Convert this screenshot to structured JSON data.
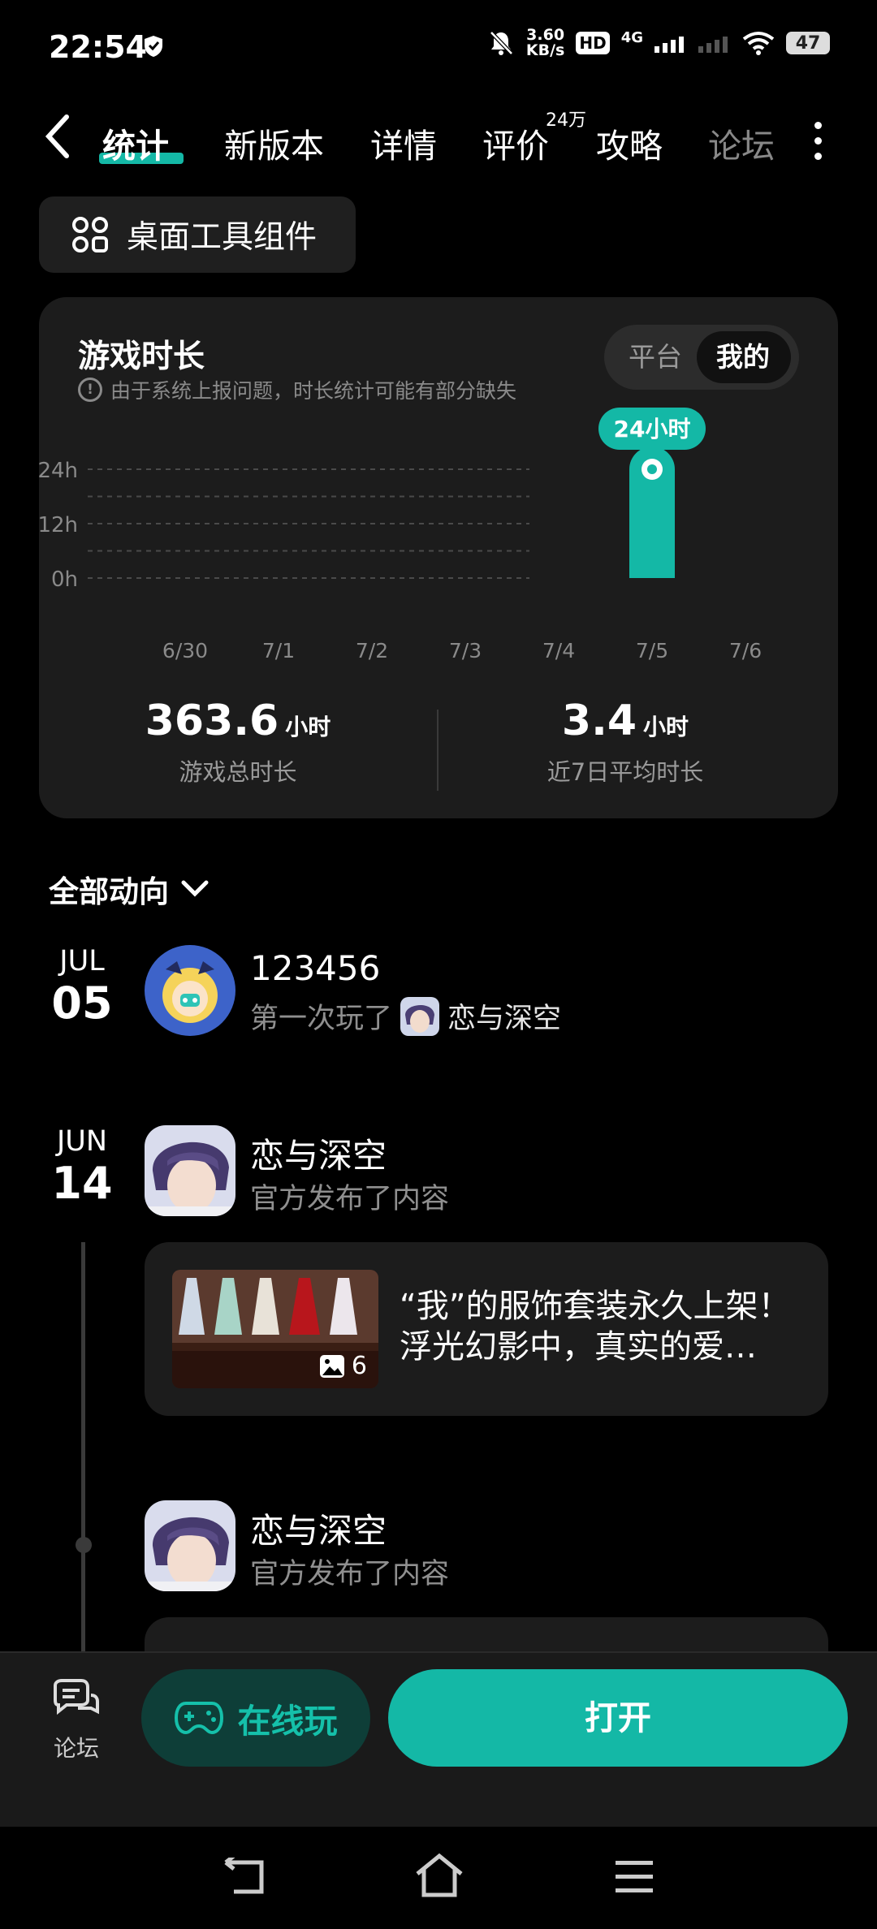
{
  "status_bar": {
    "time": "22:54",
    "net_speed_value": "3.60",
    "net_speed_unit": "KB/s",
    "hd": "HD",
    "network": "4G",
    "battery": "47"
  },
  "tabs": [
    {
      "label": "统计"
    },
    {
      "label": "新版本"
    },
    {
      "label": "详情"
    },
    {
      "label": "评价",
      "badge": "24万"
    },
    {
      "label": "攻略"
    },
    {
      "label": "论坛"
    }
  ],
  "widget_button": {
    "label": "桌面工具组件"
  },
  "stats": {
    "title": "游戏时长",
    "note": "由于系统上报问题，时长统计可能有部分缺失",
    "toggle": {
      "options": [
        "平台",
        "我的"
      ],
      "selected": "我的"
    },
    "total": {
      "value": "363.6",
      "unit": "小时",
      "label": "游戏总时长"
    },
    "average": {
      "value": "3.4",
      "unit": "小时",
      "label": "近7日平均时长"
    }
  },
  "chart_data": {
    "type": "bar",
    "categories": [
      "6/30",
      "7/1",
      "7/2",
      "7/3",
      "7/4",
      "7/5",
      "7/6"
    ],
    "values": [
      0,
      0,
      0,
      0,
      0,
      24,
      0
    ],
    "y_ticks": [
      "0h",
      "12h",
      "24h"
    ],
    "ylim": [
      0,
      24
    ],
    "highlight_label": "24小时",
    "grid": true,
    "bar_color": "#14b8a6"
  },
  "feed": {
    "filter_label": "全部动向",
    "entries": [
      {
        "month": "JUL",
        "day": "05",
        "title": "123456",
        "action": "第一次玩了",
        "game": "恋与深空"
      },
      {
        "month": "JUN",
        "day": "14",
        "title": "恋与深空",
        "action": "官方发布了内容",
        "post": {
          "text": "“我”的服饰套装永久上架！浮光幻影中，真实的爱…",
          "image_count": "6"
        }
      },
      {
        "title": "恋与深空",
        "action": "官方发布了内容"
      }
    ]
  },
  "action_bar": {
    "forum_label": "论坛",
    "play_label": "在线玩",
    "open_label": "打开"
  },
  "colors": {
    "accent": "#14b8a6",
    "background": "#000000",
    "card": "#1c1c1c"
  }
}
